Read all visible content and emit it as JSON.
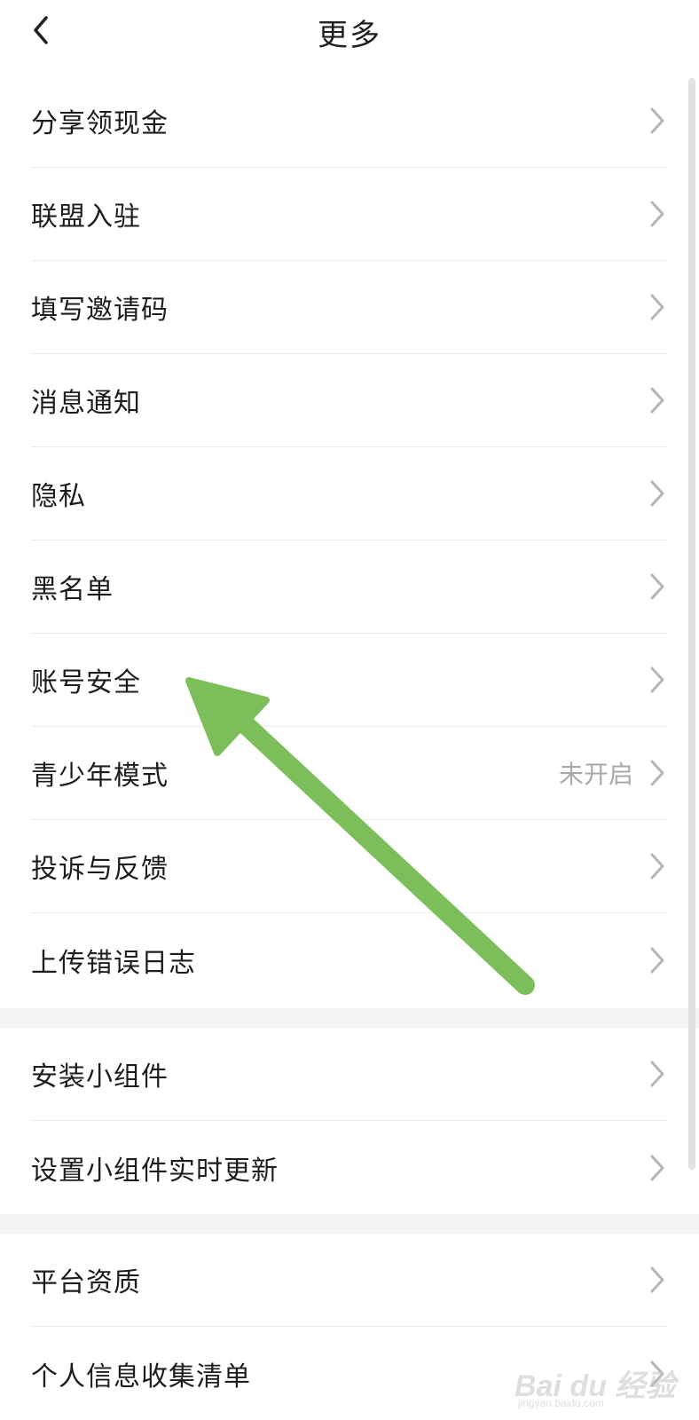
{
  "header": {
    "title": "更多"
  },
  "groups": [
    {
      "items": [
        {
          "label": "分享领现金"
        },
        {
          "label": "联盟入驻"
        },
        {
          "label": "填写邀请码"
        },
        {
          "label": "消息通知"
        },
        {
          "label": "隐私"
        },
        {
          "label": "黑名单"
        },
        {
          "label": "账号安全"
        },
        {
          "label": "青少年模式",
          "value": "未开启"
        },
        {
          "label": "投诉与反馈"
        },
        {
          "label": "上传错误日志"
        }
      ]
    },
    {
      "items": [
        {
          "label": "安装小组件"
        },
        {
          "label": "设置小组件实时更新"
        }
      ]
    },
    {
      "items": [
        {
          "label": "平台资质"
        },
        {
          "label": "个人信息收集清单"
        }
      ]
    }
  ],
  "icons": {
    "back": "chevron-left-icon",
    "row_arrow": "chevron-right-icon"
  },
  "overlay": {
    "arrow_color": "#7cbf5a",
    "points_to": "账号安全"
  },
  "watermark": {
    "brand": "Bai du 经验",
    "url": "jingyan.baidu.com"
  }
}
